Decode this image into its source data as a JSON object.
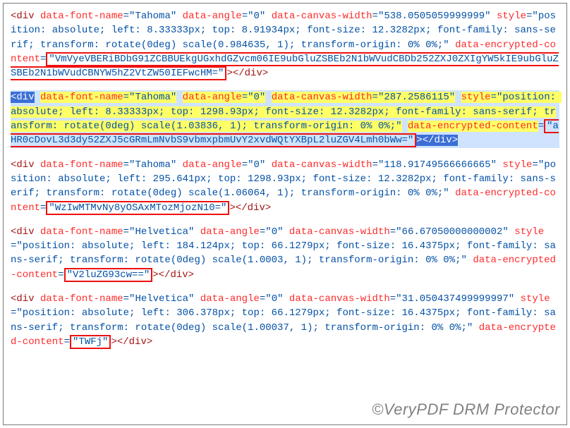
{
  "blocks": [
    {
      "type": "div",
      "selected": false,
      "font": "Tahoma",
      "angle": "0",
      "canvasWidth": "538.0505059999999",
      "style": "position: absolute; left: 8.33333px; top: 8.91934px; font-size: 12.3282px; font-family: sans-serif; transform: rotate(0deg) scale(0.984635, 1); transform-origin: 0% 0%;",
      "encrypted": "VmVyeVBERiBDbG91ZCBBUEkgUGxhdGZvcm06IE9ubGluZSBEb2N1bWVudCBDb252ZXJ0ZXIgYW5kIE9ubGluZSBEb2N1bWVudCBNYW5hZ2VtZW50IEFwcHM="
    },
    {
      "type": "div",
      "selected": true,
      "font": "Tahoma",
      "angle": "0",
      "canvasWidth": "287.2586115",
      "style": "position: absolute; left: 8.33333px; top: 1298.93px; font-size: 12.3282px; font-family: sans-serif; transform: rotate(0deg) scale(1.03836, 1); transform-origin: 0% 0%;",
      "encrypted": "aHR0cDovL3d3dy52ZXJ5cGRmLmNvbS9vbmxpbmUvY2xvdWQtYXBpL2luZGV4Lmh0bWw="
    },
    {
      "type": "div",
      "selected": false,
      "font": "Tahoma",
      "angle": "0",
      "canvasWidth": "118.91749566666665",
      "style": "position: absolute; left: 295.641px; top: 1298.93px; font-size: 12.3282px; font-family: sans-serif; transform: rotate(0deg) scale(1.06064, 1); transform-origin: 0% 0%;",
      "encrypted": "WzIwMTMvNy8yOSAxMTozMjozN10="
    },
    {
      "type": "div",
      "selected": false,
      "font": "Helvetica",
      "angle": "0",
      "canvasWidth": "66.67050000000002",
      "style": "position: absolute; left: 184.124px; top: 66.1279px; font-size: 16.4375px; font-family: sans-serif; transform: rotate(0deg) scale(1.0003, 1); transform-origin: 0% 0%;",
      "encrypted": "V2luZG93cw=="
    },
    {
      "type": "div",
      "selected": false,
      "font": "Helvetica",
      "angle": "0",
      "canvasWidth": "31.050437499999997",
      "style": "position: absolute; left: 306.378px; top: 66.1279px; font-size: 16.4375px; font-family: sans-serif; transform: rotate(0deg) scale(1.00037, 1); transform-origin: 0% 0%;",
      "encrypted": "TWFj"
    }
  ],
  "watermark": "©VeryPDF DRM Protector"
}
